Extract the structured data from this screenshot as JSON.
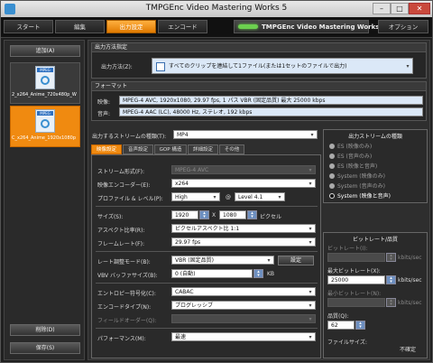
{
  "window": {
    "title": "TMPGEnc Video Mastering Works 5"
  },
  "nav": {
    "tabs": [
      "スタート",
      "編集",
      "出力設定",
      "エンコード"
    ],
    "brand": "TMPGEnc Video Mastering Works 5",
    "options": "オプション"
  },
  "sidebar": {
    "add": "追加(A)",
    "clips": [
      {
        "tag": "MPEG",
        "name": "2_x264_Anime_720x480p_W"
      },
      {
        "tag": "MPEG",
        "name": "C_x264_Anime_1920x1080p"
      }
    ],
    "delete": "削除(D)",
    "save": "保存(S)"
  },
  "output_spec": {
    "header": "出力方法指定",
    "label": "出力方法(Z):",
    "value": "すべてのクリップを連結して1ファイル(または1セットのファイルで出力)"
  },
  "format": {
    "header": "フォーマット",
    "video_label": "映像:",
    "video": "MPEG-4 AVC, 1920x1080, 29.97 fps, 1 パス VBR (固定品質) 最大 25000 kbps",
    "audio_label": "音声:",
    "audio": "MPEG-4 AAC (LC), 48000 Hz, ステレオ, 192 kbps"
  },
  "stream_select": {
    "label": "出力するストリームの種類(T):",
    "value": "MP4"
  },
  "tabs": [
    "映像設定",
    "音声設定",
    "GOP 構造",
    "詳細設定",
    "その他"
  ],
  "video": {
    "stream_format_label": "ストリーム形式(F):",
    "stream_format": "MPEG-4 AVC",
    "encoder_label": "映像エンコーダー(E):",
    "encoder": "x264",
    "profile_label": "プロファイル & レベル(P):",
    "profile": "High",
    "at": "@",
    "level": "Level 4.1",
    "size_label": "サイズ(S):",
    "width": "1920",
    "times": "X",
    "height": "1080",
    "pixel": "ピクセル",
    "aspect_label": "アスペクト比率(R):",
    "aspect": "ピクセルアスペクト比 1:1",
    "framerate_label": "フレームレート(F):",
    "framerate": "29.97 fps",
    "rate_mode_label": "レート調整モード(B):",
    "rate_mode": "VBR (固定品質)",
    "settings_btn": "設定",
    "vbv_label": "VBV バッファサイズ(B):",
    "vbv": "0 (自動)",
    "kb": "KB",
    "entropy_label": "エントロピー符号化(C):",
    "entropy": "CABAC",
    "encode_type_label": "エンコードタイプ(N):",
    "encode_type": "プログレッシブ",
    "field_order_label": "フィールドオーダー(Q):",
    "performance_label": "パフォーマンス(M):",
    "performance": "最速"
  },
  "stream_types": {
    "header": "出力ストリームの種類",
    "options": [
      "ES (映像のみ)",
      "ES (音声のみ)",
      "ES (映像と音声)",
      "System (映像のみ)",
      "System (音声のみ)",
      "System (映像と音声)"
    ],
    "selected_index": 5
  },
  "bitrate": {
    "header": "ビットレート/品質",
    "bitrate_label": "ビットレート(I):",
    "unit": "kbits/sec",
    "max_label": "最大ビットレート(X):",
    "max": "25000",
    "min_label": "最小ビットレート(N):",
    "quality_label": "品質(Q):",
    "quality": "62",
    "filesize_label": "ファイルサイズ:",
    "filesize": "不確定"
  }
}
